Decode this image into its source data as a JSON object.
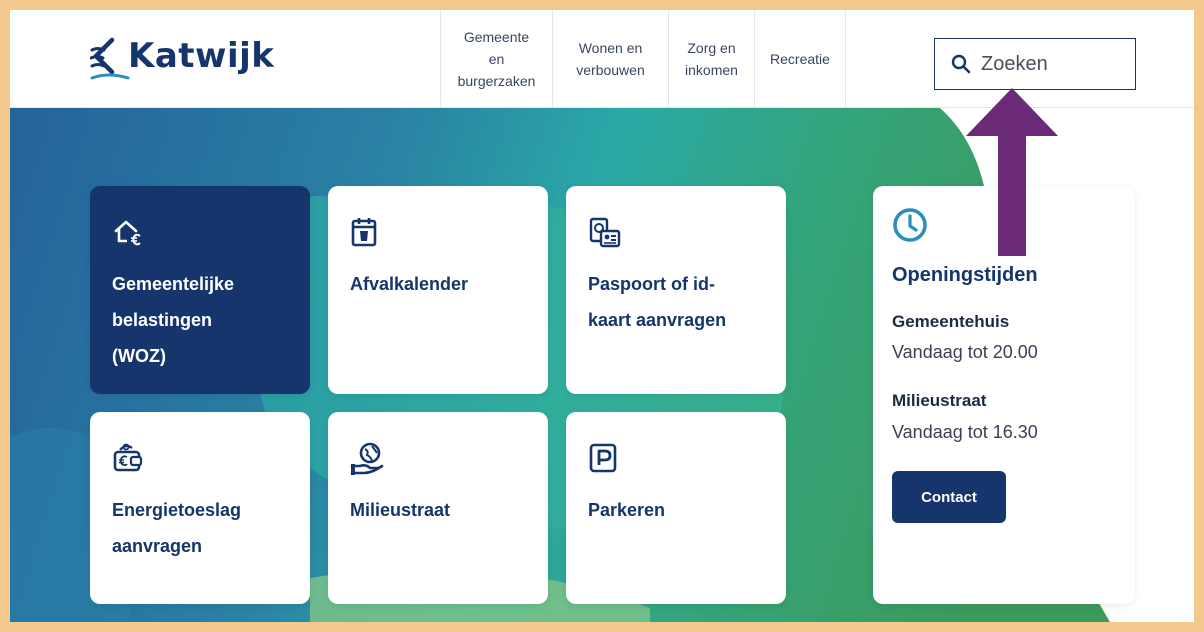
{
  "header": {
    "logo_text": "Katwijk",
    "nav": [
      {
        "label": "Gemeente en\nburgerzaken"
      },
      {
        "label": "Wonen en\nverbouwen"
      },
      {
        "label": "Zorg en\ninkomen"
      },
      {
        "label": "Recreatie"
      }
    ],
    "search": {
      "placeholder": "Zoeken",
      "icon": "search-icon"
    }
  },
  "tiles": [
    {
      "label": "Gemeentelijke\nbelastingen\n(WOZ)",
      "icon": "house-euro-icon",
      "highlighted": true
    },
    {
      "label": "Afvalkalender",
      "icon": "calendar-bin-icon"
    },
    {
      "label": "Paspoort of id-\nkaart aanvragen",
      "icon": "id-card-icon"
    },
    {
      "label": "Energietoeslag\naanvragen",
      "icon": "wallet-euro-icon"
    },
    {
      "label": "Milieustraat",
      "icon": "hand-globe-icon"
    },
    {
      "label": "Parkeren",
      "icon": "parking-icon"
    }
  ],
  "opening_hours": {
    "title": "Openingstijden",
    "icon": "clock-icon",
    "locations": [
      {
        "name": "Gemeentehuis",
        "hours": "Vandaag tot 20.00"
      },
      {
        "name": "Milieustraat",
        "hours": "Vandaag tot 16.30"
      }
    ],
    "contact_label": "Contact"
  },
  "annotation": {
    "arrow_color": "#6b2a78",
    "points_to": "search-input"
  },
  "colors": {
    "brand_navy": "#16356c",
    "page_border": "#f4c98e",
    "gradient_blue": "#24629b",
    "gradient_teal": "#2aa9a6",
    "gradient_green": "#3aa064"
  }
}
